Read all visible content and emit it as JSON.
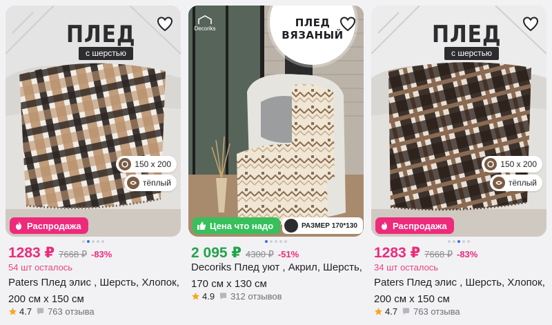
{
  "products": [
    {
      "banner_title": "ПЛЕД",
      "banner_sub": "с шерстью",
      "features": {
        "size": "150 x 200",
        "warm": "тёплый"
      },
      "promo_label": "Распродажа",
      "price": "1283 ₽",
      "old_price": "7668 ₽",
      "discount": "-83%",
      "stock": "54 шт осталось",
      "title": "Paters Плед элис , Шерсть, Хлопок, 200 см х 150 см",
      "rating": "4.7",
      "reviews": "763 отзыва",
      "carousel": {
        "active": 1,
        "count": 5
      },
      "colors": {
        "plaid_dark": "#2b2420",
        "plaid_tan": "#b98f6a"
      }
    },
    {
      "badge_line1": "ПЛЕД",
      "badge_line2": "ВЯЗАНЫЙ",
      "brand_logo": "Decoriks",
      "promo_label": "Цена что надо",
      "size_chip": "РАЗМЕР 170*130",
      "price": "2 095 ₽",
      "old_price": "4300 ₽",
      "discount": "-51%",
      "title": "Decoriks Плед уют , Акрил, Шерсть, 170 см х 130 см",
      "rating": "4.9",
      "reviews": "312 отзывов",
      "carousel": {
        "active": 0,
        "count": 5
      }
    },
    {
      "banner_title": "ПЛЕД",
      "banner_sub": "с шерстью",
      "features": {
        "size": "150 x 200",
        "warm": "тёплый"
      },
      "promo_label": "Распродажа",
      "price": "1283 ₽",
      "old_price": "7668 ₽",
      "discount": "-83%",
      "stock": "34 шт осталось",
      "title": "Paters Плед элис , Шерсть, Хлопок, 200 см х 150 см",
      "rating": "4.7",
      "reviews": "763 отзыва",
      "carousel": {
        "active": 2,
        "count": 5
      },
      "colors": {
        "plaid_dark": "#2a1f18",
        "plaid_tan": "#8a6a52"
      }
    }
  ],
  "icons": {
    "favorite": "heart-outline-icon",
    "sale": "flame-icon",
    "good_price": "thumbs-up-icon",
    "rating": "star-icon",
    "reviews": "speech-bubble-icon"
  },
  "colors": {
    "accent_pink": "#ee2a7b",
    "accent_green": "#22a34a",
    "star": "#f5a623"
  }
}
